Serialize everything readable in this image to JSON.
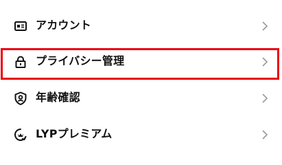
{
  "menu": {
    "items": [
      {
        "label": "アカウント",
        "icon": "account-card-icon"
      },
      {
        "label": "プライバシー管理",
        "icon": "lock-icon",
        "highlighted": true
      },
      {
        "label": "年齢確認",
        "icon": "shield-person-icon"
      },
      {
        "label": "LYPプレミアム",
        "icon": "premium-badge-icon"
      }
    ]
  },
  "colors": {
    "highlight_border": "#e8000b",
    "text": "#111111",
    "chevron": "#9a9a9a"
  }
}
